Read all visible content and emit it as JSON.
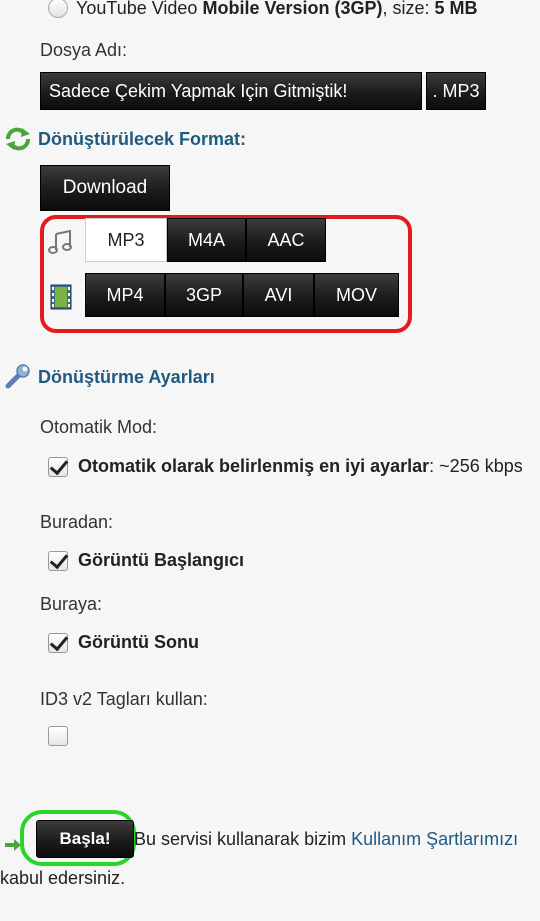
{
  "video_option": {
    "prefix": "YouTube Video ",
    "bold": "Mobile Version (3GP)",
    "size_label": ", size: ",
    "size_value": "5 MB"
  },
  "filename": {
    "label": "Dosya Adı:",
    "value": "Sadece Çekim Yapmak Için Gitmiştik!",
    "extension": ". MP3"
  },
  "convert_format": {
    "title": "Dönüştürülecek Format:",
    "download_label": "Download",
    "audio_formats": [
      "MP3",
      "M4A",
      "AAC"
    ],
    "video_formats": [
      "MP4",
      "3GP",
      "AVI",
      "MOV"
    ],
    "selected": "MP3"
  },
  "settings": {
    "title": "Dönüştürme Ayarları",
    "auto_mode_label": "Otomatik Mod:",
    "auto_mode_option": "Otomatik olarak belirlenmiş en iyi ayarlar",
    "auto_mode_suffix": " : ~256 kbps",
    "from_label": "Buradan:",
    "from_option": "Görüntü Başlangıcı",
    "to_label": "Buraya:",
    "to_option": "Görüntü Sonu",
    "id3_label": "ID3 v2 Tagları kullan:"
  },
  "footer": {
    "start_label": "Başla!",
    "terms_prefix": " Bu servisi kullanarak bizim ",
    "terms_link": "Kullanım Şartlarımızı",
    "terms_suffix": "kabul edersiniz."
  },
  "colors": {
    "accent": "#1f5a83",
    "highlight_red": "#e31b1b",
    "highlight_green": "#2ad42a"
  }
}
